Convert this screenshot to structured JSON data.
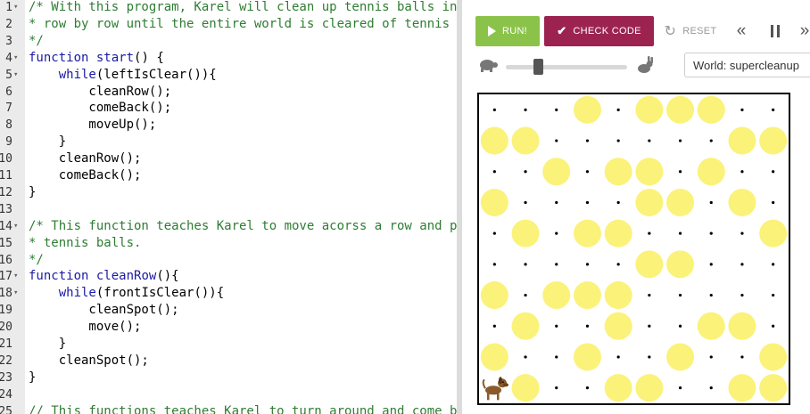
{
  "editor": {
    "lines": [
      {
        "n": "1",
        "fold": true,
        "html": "<span class='cm'>/* With this program, Karel will clean up tennis balls in</span>"
      },
      {
        "n": "2",
        "fold": false,
        "html": "<span class='cm'>* row by row until the entire world is cleared of tennis</span>"
      },
      {
        "n": "3",
        "fold": false,
        "html": "<span class='cm'>*/</span>"
      },
      {
        "n": "4",
        "fold": true,
        "html": "<span class='kw'>function</span> <span class='fn'>start</span>() {"
      },
      {
        "n": "5",
        "fold": true,
        "html": "    <span class='kw'>while</span>(leftIsClear()){"
      },
      {
        "n": "6",
        "fold": false,
        "html": "        cleanRow();"
      },
      {
        "n": "7",
        "fold": false,
        "html": "        comeBack();"
      },
      {
        "n": "8",
        "fold": false,
        "html": "        moveUp();"
      },
      {
        "n": "9",
        "fold": false,
        "html": "    }"
      },
      {
        "n": "10",
        "fold": false,
        "html": "    cleanRow();"
      },
      {
        "n": "11",
        "fold": false,
        "html": "    comeBack();"
      },
      {
        "n": "12",
        "fold": false,
        "html": "}"
      },
      {
        "n": "13",
        "fold": false,
        "html": ""
      },
      {
        "n": "14",
        "fold": true,
        "html": "<span class='cm'>/* This function teaches Karel to move acorss a row and p</span>"
      },
      {
        "n": "15",
        "fold": false,
        "html": "<span class='cm'>* tennis balls.</span>"
      },
      {
        "n": "16",
        "fold": false,
        "html": "<span class='cm'>*/</span>"
      },
      {
        "n": "17",
        "fold": true,
        "html": "<span class='kw'>function</span> <span class='fn'>cleanRow</span>(){"
      },
      {
        "n": "18",
        "fold": true,
        "html": "    <span class='kw'>while</span>(frontIsClear()){"
      },
      {
        "n": "19",
        "fold": false,
        "html": "        cleanSpot();"
      },
      {
        "n": "20",
        "fold": false,
        "html": "        move();"
      },
      {
        "n": "21",
        "fold": false,
        "html": "    }"
      },
      {
        "n": "22",
        "fold": false,
        "html": "    cleanSpot();"
      },
      {
        "n": "23",
        "fold": false,
        "html": "}"
      },
      {
        "n": "24",
        "fold": false,
        "html": ""
      },
      {
        "n": "25",
        "fold": false,
        "html": "<span class='cm'>// This functions teaches Karel to turn around and come b</span>"
      }
    ]
  },
  "toolbar": {
    "run_label": "RUN!",
    "check_label": "CHECK CODE",
    "reset_label": "RESET"
  },
  "world": {
    "select_label": "World: supercleanup",
    "cols": 10,
    "rows": 10,
    "ball_color": "#fbf27a",
    "balls": [
      [
        3,
        0
      ],
      [
        5,
        0
      ],
      [
        6,
        0
      ],
      [
        7,
        0
      ],
      [
        0,
        1
      ],
      [
        1,
        1
      ],
      [
        8,
        1
      ],
      [
        9,
        1
      ],
      [
        2,
        2
      ],
      [
        4,
        2
      ],
      [
        5,
        2
      ],
      [
        7,
        2
      ],
      [
        0,
        3
      ],
      [
        5,
        3
      ],
      [
        6,
        3
      ],
      [
        8,
        3
      ],
      [
        1,
        4
      ],
      [
        3,
        4
      ],
      [
        4,
        4
      ],
      [
        9,
        4
      ],
      [
        5,
        5
      ],
      [
        6,
        5
      ],
      [
        0,
        6
      ],
      [
        2,
        6
      ],
      [
        3,
        6
      ],
      [
        4,
        6
      ],
      [
        1,
        7
      ],
      [
        4,
        7
      ],
      [
        7,
        7
      ],
      [
        8,
        7
      ],
      [
        0,
        8
      ],
      [
        3,
        8
      ],
      [
        6,
        8
      ],
      [
        9,
        8
      ],
      [
        1,
        9
      ],
      [
        4,
        9
      ],
      [
        5,
        9
      ],
      [
        8,
        9
      ],
      [
        9,
        9
      ]
    ],
    "karel": {
      "col": 0,
      "row": 9
    }
  },
  "colors": {
    "run": "#8bc34a",
    "check": "#9c2350",
    "comment": "#2e7d32",
    "keyword": "#1a1aa6"
  }
}
